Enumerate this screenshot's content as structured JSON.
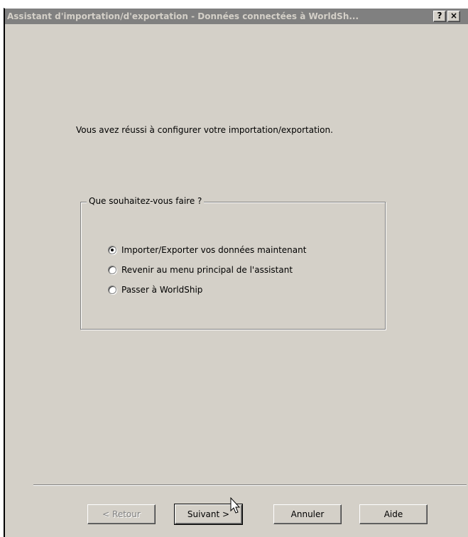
{
  "window": {
    "title": "Assistant d'importation/d'exportation - Données connectées à WorldSh...",
    "help_button": "?",
    "close_button": "×"
  },
  "main": {
    "message": "Vous avez réussi à configurer votre importation/exportation.",
    "group_title": "Que souhaitez-vous faire ?",
    "options": [
      {
        "label": "Importer/Exporter vos données maintenant",
        "selected": true
      },
      {
        "label": "Revenir au menu principal de l'assistant",
        "selected": false
      },
      {
        "label": "Passer à WorldShip",
        "selected": false
      }
    ]
  },
  "buttons": {
    "back": "< Retour",
    "next": "Suivant >",
    "cancel": "Annuler",
    "help": "Aide"
  },
  "colors": {
    "dialog_bg": "#d4d0c8",
    "titlebar_inactive": "#808080",
    "disabled_text": "#808080"
  },
  "icons": {
    "pointer": "arrow-cursor-icon"
  }
}
